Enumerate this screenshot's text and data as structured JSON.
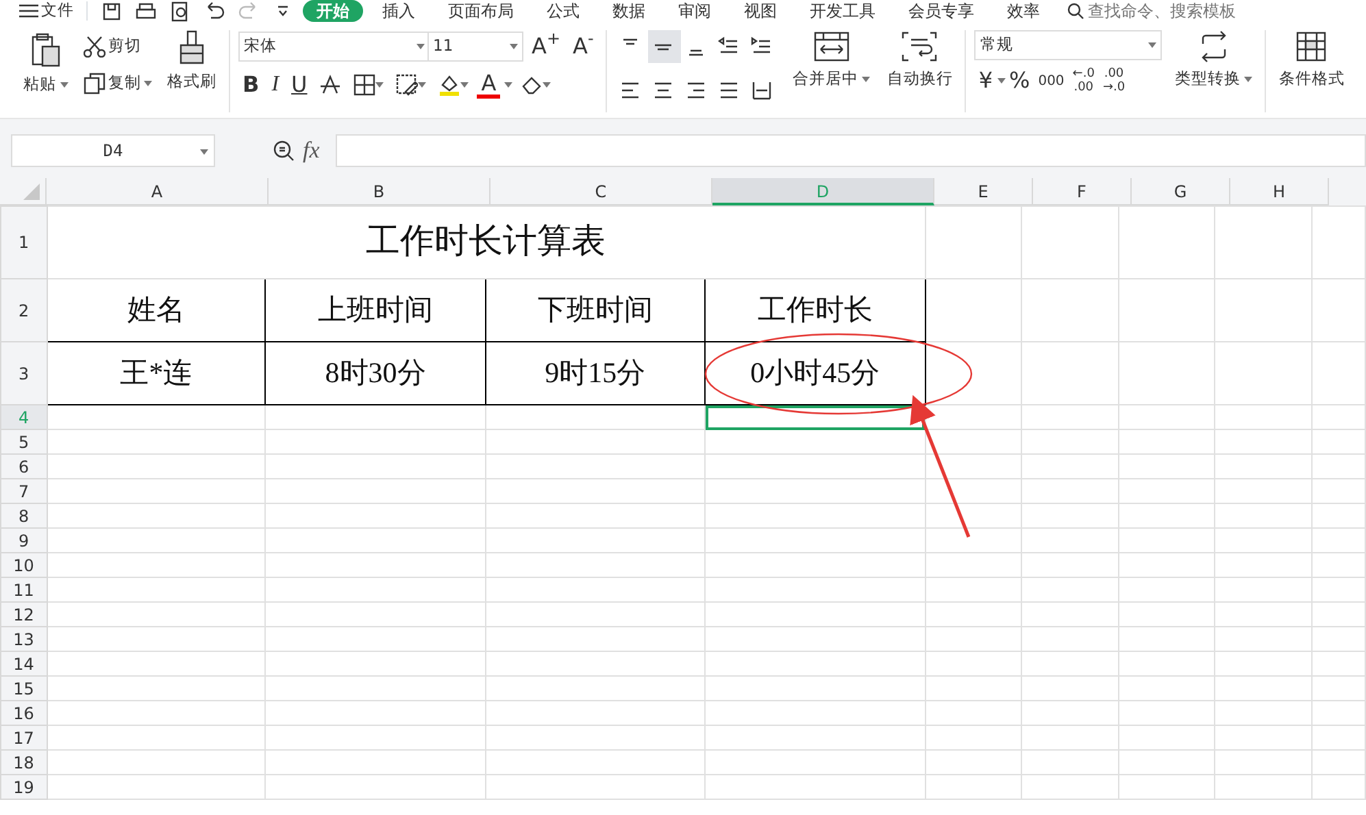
{
  "menu_button": {
    "label": "文件"
  },
  "tabs": [
    {
      "label": "开始",
      "selected": true
    },
    {
      "label": "插入",
      "selected": false
    },
    {
      "label": "页面布局",
      "selected": false
    },
    {
      "label": "公式",
      "selected": false
    },
    {
      "label": "数据",
      "selected": false
    },
    {
      "label": "审阅",
      "selected": false
    },
    {
      "label": "视图",
      "selected": false
    },
    {
      "label": "开发工具",
      "selected": false
    },
    {
      "label": "会员专享",
      "selected": false
    },
    {
      "label": "效率",
      "selected": false
    }
  ],
  "search": {
    "placeholder": "查找命令、搜索模板"
  },
  "ribbon": {
    "paste": "粘贴",
    "cut": "剪切",
    "copy": "复制",
    "format_painter": "格式刷",
    "font_name": "宋体",
    "font_size": "11",
    "grow_font": "A$^{+}$",
    "shrink_font": "A$^{-}$",
    "bold": "B",
    "italic": "I",
    "underline": "U",
    "font_color": "A",
    "merge_center": "合并居中",
    "wrap_text": "自动换行",
    "number_format": "常规",
    "currency": "¥",
    "percent": "%",
    "thousands": "000",
    "increase_decimal": [
      "←.0",
      ".00"
    ],
    "decrease_decimal": [
      ".00",
      "→.0"
    ],
    "convert_type": "类型转换",
    "conditional_format": "条件格式"
  },
  "name_box": "D4",
  "formula_label": "fx",
  "columns": [
    {
      "label": "A",
      "selected": false
    },
    {
      "label": "B",
      "selected": false
    },
    {
      "label": "C",
      "selected": false
    },
    {
      "label": "D",
      "selected": true
    },
    {
      "label": "E",
      "selected": false
    },
    {
      "label": "F",
      "selected": false
    },
    {
      "label": "G",
      "selected": false
    },
    {
      "label": "H",
      "selected": false
    }
  ],
  "rows": [
    {
      "label": "1",
      "kind": "title",
      "selected": false,
      "cells": [
        "工作时长计算表"
      ]
    },
    {
      "label": "2",
      "kind": "table",
      "selected": false,
      "cells": [
        "姓名",
        "上班时间",
        "下班时间",
        "工作时长"
      ]
    },
    {
      "label": "3",
      "kind": "table",
      "selected": false,
      "cells": [
        "王*连",
        "8时30分",
        "9时15分",
        "0小时45分"
      ]
    },
    {
      "label": "4",
      "kind": "plain",
      "selected": true
    },
    {
      "label": "5",
      "kind": "plain",
      "selected": false
    },
    {
      "label": "6",
      "kind": "plain",
      "selected": false
    },
    {
      "label": "7",
      "kind": "plain",
      "selected": false
    },
    {
      "label": "8",
      "kind": "plain",
      "selected": false
    },
    {
      "label": "9",
      "kind": "plain",
      "selected": false
    },
    {
      "label": "10",
      "kind": "plain",
      "selected": false
    },
    {
      "label": "11",
      "kind": "plain",
      "selected": false
    },
    {
      "label": "12",
      "kind": "plain",
      "selected": false
    },
    {
      "label": "13",
      "kind": "plain",
      "selected": false
    },
    {
      "label": "14",
      "kind": "plain",
      "selected": false
    },
    {
      "label": "15",
      "kind": "plain",
      "selected": false
    },
    {
      "label": "16",
      "kind": "plain",
      "selected": false
    },
    {
      "label": "17",
      "kind": "plain",
      "selected": false
    },
    {
      "label": "18",
      "kind": "plain",
      "selected": false
    },
    {
      "label": "19",
      "kind": "plain",
      "selected": false
    }
  ]
}
